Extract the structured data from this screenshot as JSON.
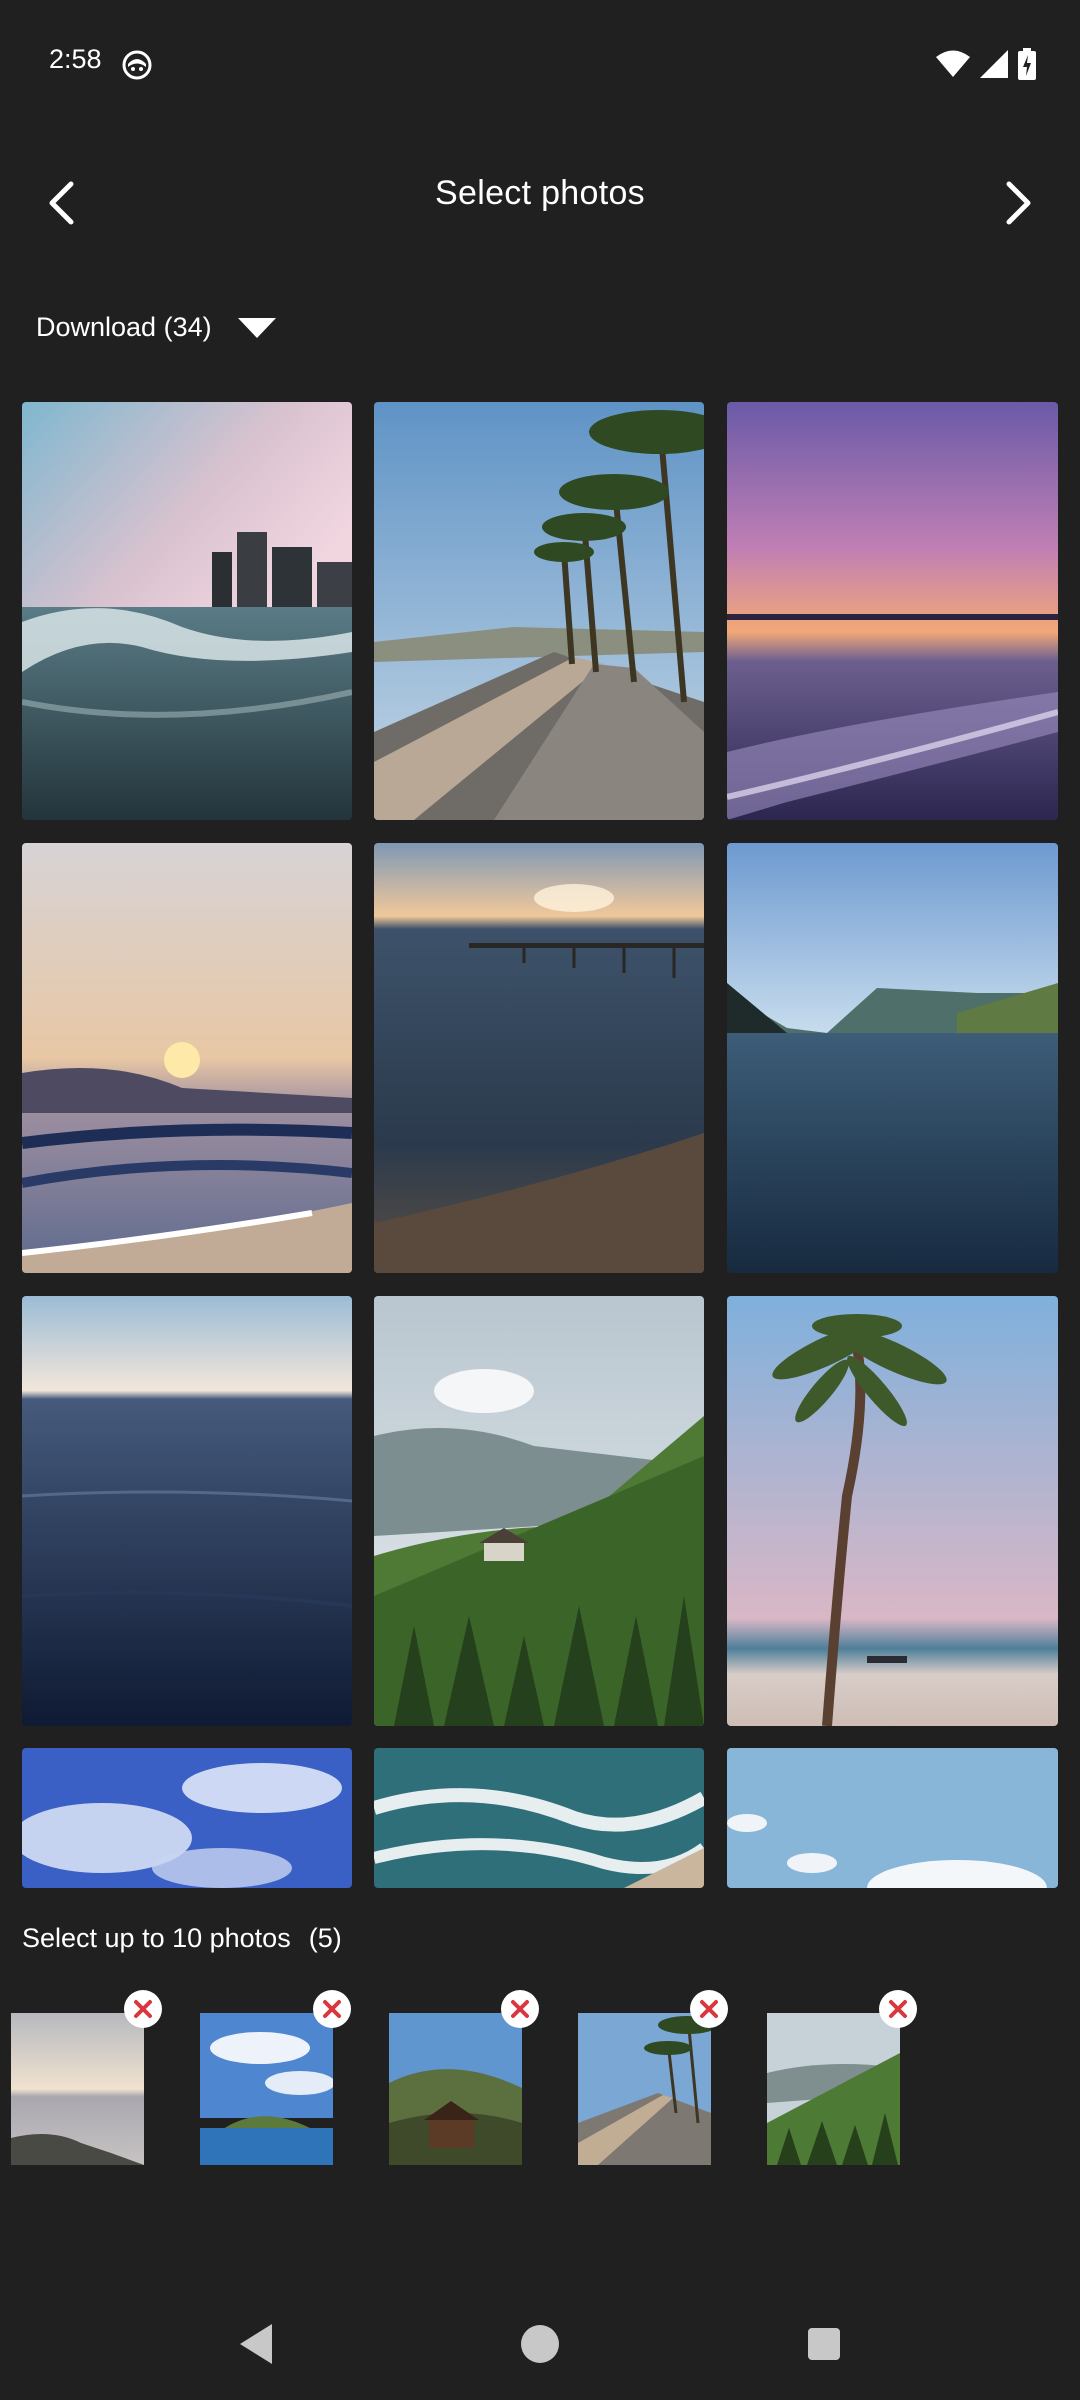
{
  "status_bar": {
    "time": "2:58"
  },
  "header": {
    "title": "Select photos"
  },
  "album": {
    "label": "Download (34)"
  },
  "selection": {
    "limit_label": "Select up to 10 photos",
    "count_label": "(5)"
  },
  "icons": {
    "back": "chevron-left-icon",
    "next": "chevron-right-icon",
    "dropdown": "triangle-down-icon",
    "remove": "close-icon",
    "wifi": "wifi-icon",
    "signal": "signal-icon",
    "battery": "battery-charging-icon",
    "nav_back": "nav-back-icon",
    "nav_home": "nav-home-icon",
    "nav_recents": "nav-recents-icon"
  },
  "colors": {
    "background": "#202020",
    "remove_x": "#d9363e"
  }
}
